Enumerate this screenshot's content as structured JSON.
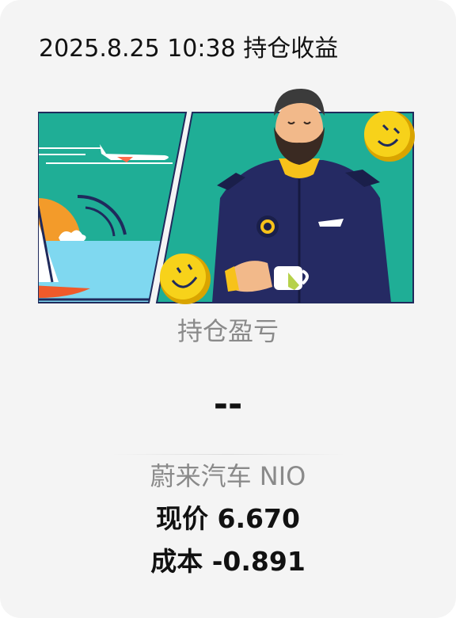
{
  "header": {
    "datetime": "2025.8.25 10:38",
    "title": "持仓收益"
  },
  "illustration": {
    "description_icons": [
      "airplane-icon",
      "sun-icon",
      "sailboat-icon",
      "smiley-coin-icon",
      "captain-character"
    ],
    "colors": {
      "teal": "#1fae96",
      "navy": "#252a63",
      "yellow": "#f7d21a",
      "orange": "#f39b2a",
      "sea": "#7fd8f0"
    }
  },
  "position": {
    "label": "持仓盈亏",
    "value": "--"
  },
  "stock": {
    "name": "蔚来汽车 NIO",
    "price_label": "现价",
    "price": "6.670",
    "cost_label": "成本",
    "cost": "-0.891"
  }
}
